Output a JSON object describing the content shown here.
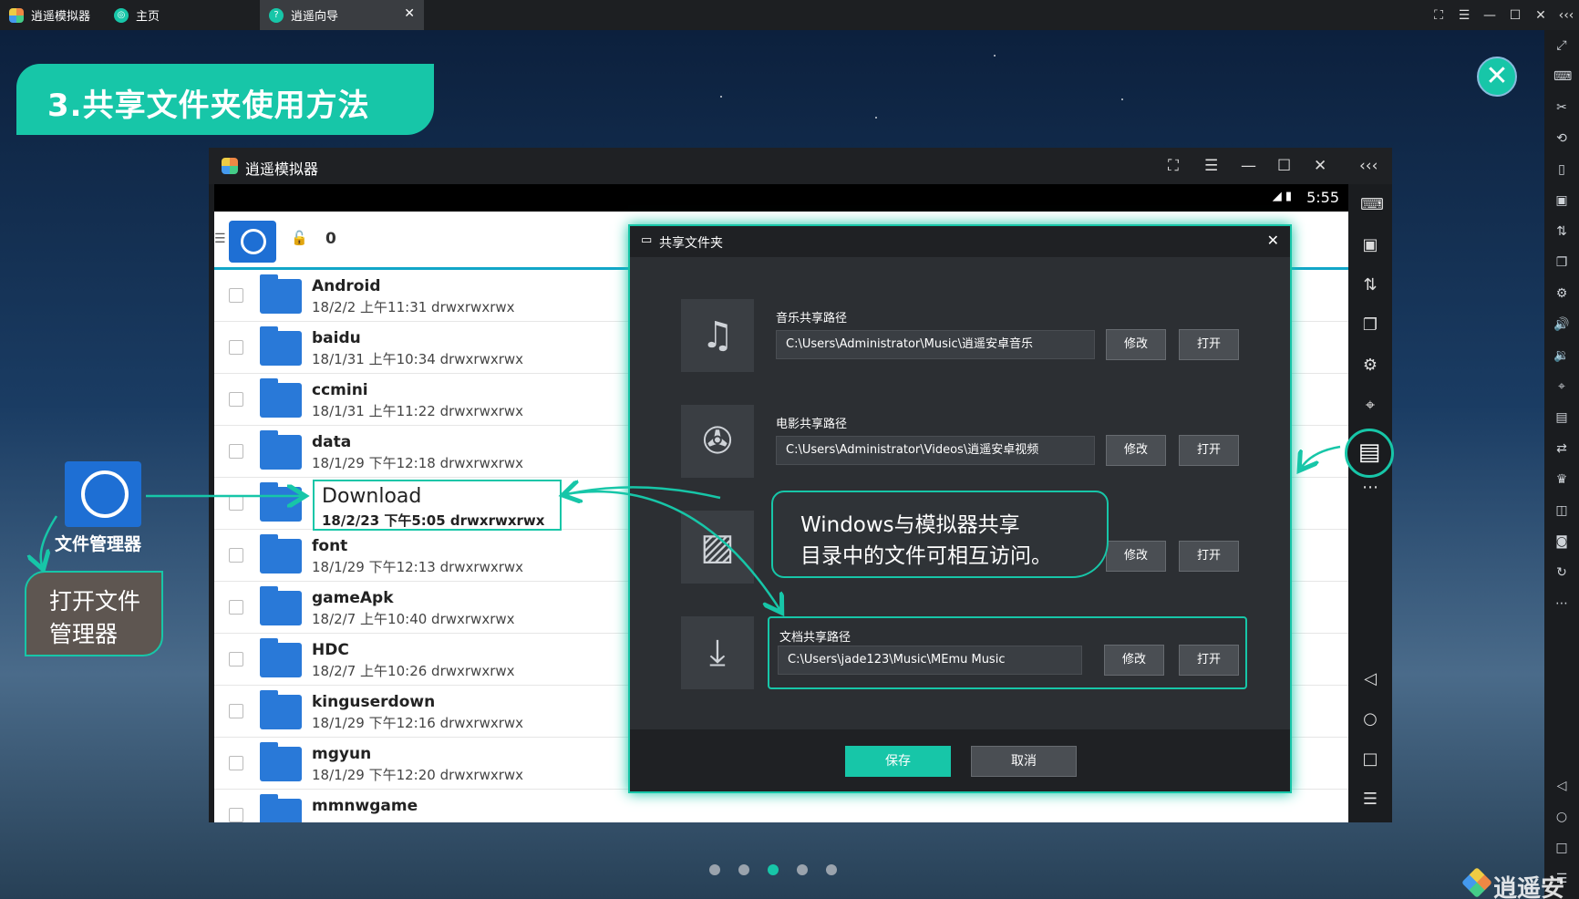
{
  "top_tabs": [
    {
      "label": "逍遥模拟器",
      "icon": "memu-logo-icon"
    },
    {
      "label": "主页",
      "icon": "home-icon"
    },
    {
      "label": "逍遥向导",
      "icon": "guide-icon"
    }
  ],
  "heading": "3.共享文件夹使用方法",
  "emulator": {
    "title": "逍遥模拟器",
    "time": "5:55",
    "path_count": "0"
  },
  "file_list": [
    {
      "name": "Android",
      "meta": "18/2/2 上午11:31   drwxrwxrwx"
    },
    {
      "name": "baidu",
      "meta": "18/1/31 上午10:34   drwxrwxrwx"
    },
    {
      "name": "ccmini",
      "meta": "18/1/31 上午11:22   drwxrwxrwx"
    },
    {
      "name": "data",
      "meta": "18/1/29 下午12:18   drwxrwxrwx"
    },
    {
      "name": "",
      "meta": ""
    },
    {
      "name": "font",
      "meta": "18/1/29 下午12:13   drwxrwxrwx"
    },
    {
      "name": "gameApk",
      "meta": "18/2/7 上午10:40   drwxrwxrwx"
    },
    {
      "name": "HDC",
      "meta": "18/2/7 上午10:26   drwxrwxrwx"
    },
    {
      "name": "kinguserdown",
      "meta": "18/1/29 下午12:16   drwxrwxrwx"
    },
    {
      "name": "mgyun",
      "meta": "18/1/29 下午12:20   drwxrwxrwx"
    },
    {
      "name": "mmnwgame",
      "meta": ""
    }
  ],
  "download_highlight": {
    "name": "Download",
    "meta": "18/2/23 下午5:05 drwxrwxrwx"
  },
  "dialog": {
    "title": "共享文件夹",
    "music_label": "音乐共享路径",
    "music_path": "C:\\Users\\Administrator\\Music\\逍遥安卓音乐",
    "video_label": "电影共享路径",
    "video_path": "C:\\Users\\Administrator\\Videos\\逍遥安卓视频",
    "doc_label": "文档共享路径",
    "doc_path": "C:\\Users\\jade123\\Music\\MEmu Music",
    "modify": "修改",
    "open": "打开",
    "save": "保存",
    "cancel": "取消"
  },
  "callout": {
    "line1": "Windows与模拟器共享",
    "line2": "目录中的文件可相互访问。"
  },
  "left": {
    "fm_label": "文件管理器",
    "open_line1": "打开文件",
    "open_line2": "管理器"
  },
  "brand": "逍遥安",
  "pagination": {
    "total": 5,
    "active": 3
  },
  "accent_color": "#17c6a8"
}
